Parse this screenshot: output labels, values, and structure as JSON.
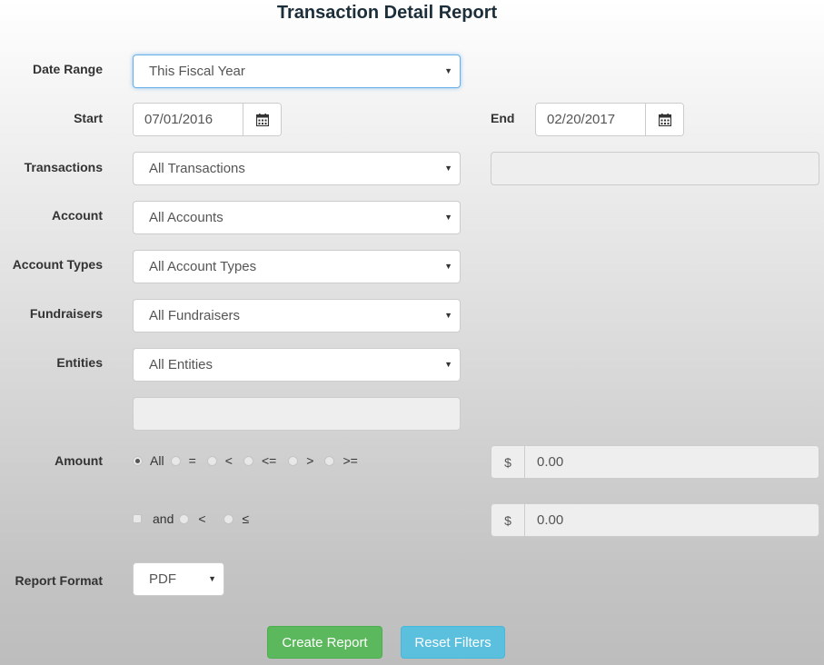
{
  "title": "Transaction Detail Report",
  "labels": {
    "date_range": "Date Range",
    "start": "Start",
    "end": "End",
    "transactions": "Transactions",
    "account": "Account",
    "account_types": "Account Types",
    "fundraisers": "Fundraisers",
    "entities": "Entities",
    "amount": "Amount",
    "report_format": "Report Format"
  },
  "selects": {
    "date_range": "This Fiscal Year",
    "transactions": "All Transactions",
    "account": "All Accounts",
    "account_types": "All Account Types",
    "fundraisers": "All Fundraisers",
    "entities": "All Entities",
    "report_format": "PDF"
  },
  "dates": {
    "start": "07/01/2016",
    "end": "02/20/2017"
  },
  "amount": {
    "options": [
      "All",
      "=",
      "<",
      "<=",
      ">",
      ">="
    ],
    "selected": "All",
    "and_label": "and",
    "and_options": [
      "<",
      "≤"
    ],
    "currency": "$",
    "value1": "0.00",
    "value2": "0.00"
  },
  "buttons": {
    "create": "Create Report",
    "reset": "Reset Filters"
  },
  "colors": {
    "success": "#5cb85c",
    "info": "#5bc0de",
    "focus": "#66afe9"
  },
  "icons": {
    "calendar": "calendar-icon",
    "caret": "caret-down-icon"
  }
}
